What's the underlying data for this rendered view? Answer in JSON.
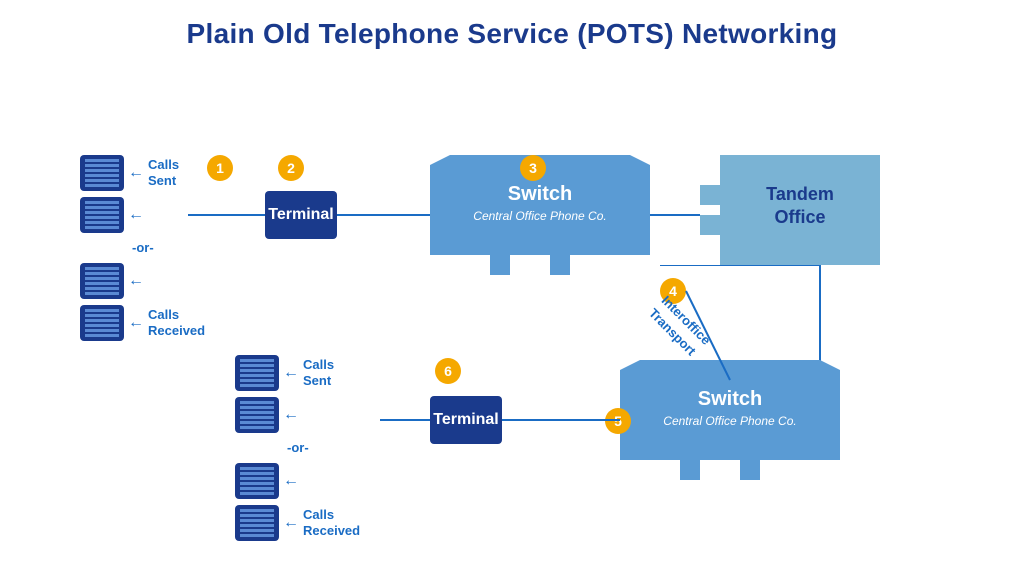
{
  "title": "Plain Old Telephone Service (POTS) Networking",
  "badges": [
    {
      "id": "1",
      "label": "1"
    },
    {
      "id": "2",
      "label": "2"
    },
    {
      "id": "3",
      "label": "3"
    },
    {
      "id": "4",
      "label": "4"
    },
    {
      "id": "5",
      "label": "5"
    },
    {
      "id": "6",
      "label": "6"
    }
  ],
  "top_group": {
    "calls_sent": "Calls\nSent",
    "or": "-or-",
    "calls_received": "Calls\nReceived"
  },
  "bottom_group": {
    "calls_sent": "Calls\nSent",
    "or": "-or-",
    "calls_received": "Calls\nReceived"
  },
  "terminal1": "Terminal",
  "terminal2": "Terminal",
  "switch_top": {
    "title": "Switch",
    "subtitle": "Central Office Phone Co."
  },
  "switch_bottom": {
    "title": "Switch",
    "subtitle": "Central Office Phone Co."
  },
  "tandem": {
    "title": "Tandem Office"
  },
  "interoffice": "Interoffice\nTransport",
  "colors": {
    "dark_blue": "#1a3a8c",
    "mid_blue": "#4a7fc1",
    "light_blue": "#a8c8e8",
    "lighter_blue": "#c5ddf0",
    "gold": "#f5a800",
    "white": "#ffffff",
    "link_blue": "#1a6cc4"
  }
}
